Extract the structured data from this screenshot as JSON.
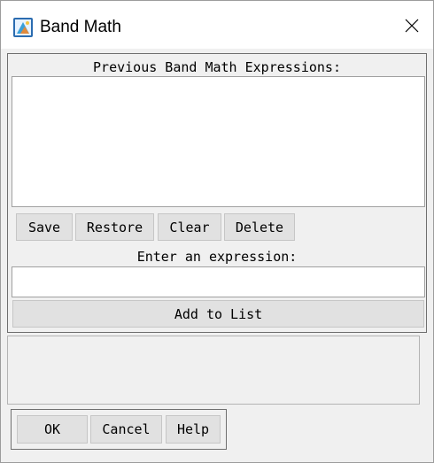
{
  "window": {
    "title": "Band Math",
    "close_icon": "close-icon",
    "app_icon": "band-math-app-icon"
  },
  "expressions_panel": {
    "label": "Previous Band Math Expressions:",
    "items": [],
    "buttons": {
      "save": "Save",
      "restore": "Restore",
      "clear": "Clear",
      "delete": "Delete"
    }
  },
  "expression_entry": {
    "label": "Enter an expression:",
    "value": "",
    "add_button": "Add to List"
  },
  "dialog_buttons": {
    "ok": "OK",
    "cancel": "Cancel",
    "help": "Help"
  },
  "colors": {
    "title_bar": "#ffffff",
    "dialog_bg": "#f0f0f0",
    "button_bg": "#e1e1e1"
  }
}
